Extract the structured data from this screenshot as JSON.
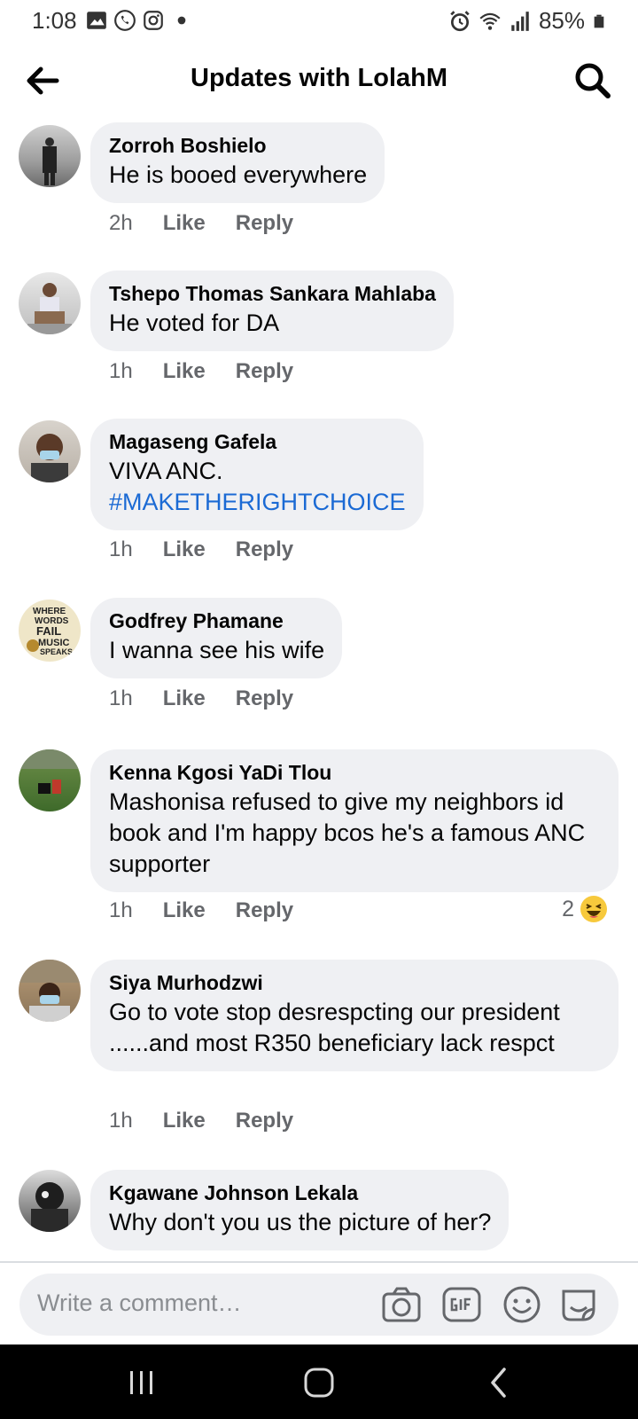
{
  "status_bar": {
    "time": "1:08",
    "battery": "85%"
  },
  "header": {
    "title": "Updates with LolahM"
  },
  "comments": [
    {
      "author": "Zorroh Boshielo",
      "text": "He is booed everywhere",
      "time": "2h",
      "like_label": "Like",
      "reply_label": "Reply"
    },
    {
      "author": "Tshepo Thomas Sankara Mahlaba",
      "text": "He voted for DA",
      "time": "1h",
      "like_label": "Like",
      "reply_label": "Reply"
    },
    {
      "author": "Magaseng Gafela",
      "text": "VIVA ANC.",
      "hashtag": "#MAKETHERIGHTCHOICE",
      "time": "1h",
      "like_label": "Like",
      "reply_label": "Reply"
    },
    {
      "author": "Godfrey Phamane",
      "text": "I wanna see his wife",
      "time": "1h",
      "like_label": "Like",
      "reply_label": "Reply",
      "avatar_text": [
        "WHERE",
        "WORDS",
        "FAIL",
        "MUSIC",
        "SPEAKS"
      ]
    },
    {
      "author": "Kenna Kgosi YaDi Tlou",
      "text": "Mashonisa refused to give my neighbors id book and I'm happy bcos he's a famous ANC supporter",
      "time": "1h",
      "like_label": "Like",
      "reply_label": "Reply",
      "reaction_count": "2",
      "reaction_icon": "laughing-emoji-icon"
    },
    {
      "author": "Siya Murhodzwi",
      "text": "Go to vote stop desrespcting our president ......and most R350 beneficiary lack respct",
      "time": "1h",
      "like_label": "Like",
      "reply_label": "Reply"
    },
    {
      "author": "Kgawane Johnson Lekala",
      "text": "Why don't you us the picture of her?"
    }
  ],
  "composer": {
    "placeholder": "Write a comment…",
    "icons": [
      "camera-icon",
      "gif-icon",
      "emoji-icon",
      "sticker-icon"
    ]
  },
  "nav_bar": {
    "icons": [
      "recents-icon",
      "home-icon",
      "back-icon"
    ]
  },
  "colors": {
    "bubble": "#eff0f3",
    "hashtag": "#1b6ad4",
    "secondary_text": "#65676b"
  }
}
